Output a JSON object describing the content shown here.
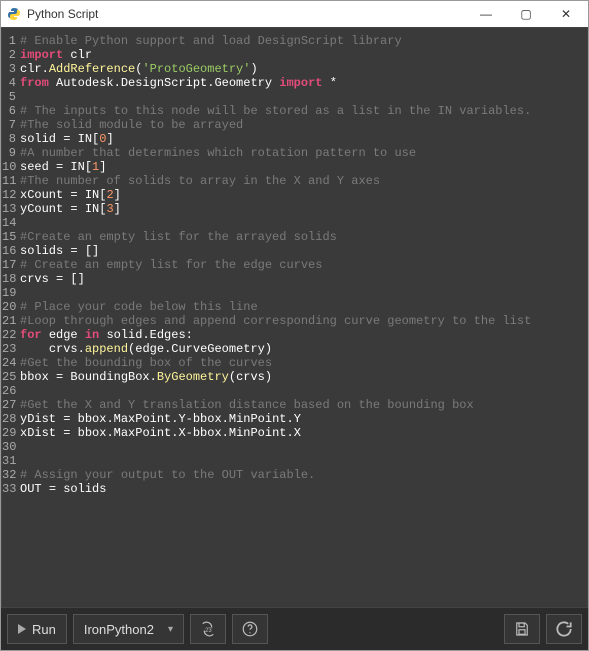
{
  "window": {
    "title": "Python Script",
    "controls": {
      "min": "—",
      "max": "▢",
      "close": "✕"
    }
  },
  "editor": {
    "total_lines": 33,
    "lines": [
      [
        {
          "t": "com",
          "s": "# Enable Python support and load DesignScript library"
        }
      ],
      [
        {
          "t": "kw",
          "s": "import"
        },
        {
          "t": null,
          "s": " "
        },
        {
          "t": "nm",
          "s": "clr"
        }
      ],
      [
        {
          "t": "nm",
          "s": "clr"
        },
        {
          "t": "op",
          "s": "."
        },
        {
          "t": "id2",
          "s": "AddReference"
        },
        {
          "t": "op",
          "s": "("
        },
        {
          "t": "str",
          "s": "'ProtoGeometry'"
        },
        {
          "t": "op",
          "s": ")"
        }
      ],
      [
        {
          "t": "kw",
          "s": "from"
        },
        {
          "t": null,
          "s": " "
        },
        {
          "t": "nm",
          "s": "Autodesk.DesignScript.Geometry"
        },
        {
          "t": null,
          "s": " "
        },
        {
          "t": "kw",
          "s": "import"
        },
        {
          "t": null,
          "s": " "
        },
        {
          "t": "op",
          "s": "*"
        }
      ],
      [],
      [
        {
          "t": "com",
          "s": "# The inputs to this node will be stored as a list in the IN variables."
        }
      ],
      [
        {
          "t": "com",
          "s": "#The solid module to be arrayed"
        }
      ],
      [
        {
          "t": "nm",
          "s": "solid "
        },
        {
          "t": "op",
          "s": "="
        },
        {
          "t": "nm",
          "s": " IN"
        },
        {
          "t": "op",
          "s": "["
        },
        {
          "t": "num",
          "s": "0"
        },
        {
          "t": "op",
          "s": "]"
        }
      ],
      [
        {
          "t": "com",
          "s": "#A number that determines which rotation pattern to use"
        }
      ],
      [
        {
          "t": "nm",
          "s": "seed "
        },
        {
          "t": "op",
          "s": "="
        },
        {
          "t": "nm",
          "s": " IN"
        },
        {
          "t": "op",
          "s": "["
        },
        {
          "t": "num",
          "s": "1"
        },
        {
          "t": "op",
          "s": "]"
        }
      ],
      [
        {
          "t": "com",
          "s": "#The number of solids to array in the X and Y axes"
        }
      ],
      [
        {
          "t": "nm",
          "s": "xCount "
        },
        {
          "t": "op",
          "s": "="
        },
        {
          "t": "nm",
          "s": " IN"
        },
        {
          "t": "op",
          "s": "["
        },
        {
          "t": "num",
          "s": "2"
        },
        {
          "t": "op",
          "s": "]"
        }
      ],
      [
        {
          "t": "nm",
          "s": "yCount "
        },
        {
          "t": "op",
          "s": "="
        },
        {
          "t": "nm",
          "s": " IN"
        },
        {
          "t": "op",
          "s": "["
        },
        {
          "t": "num",
          "s": "3"
        },
        {
          "t": "op",
          "s": "]"
        }
      ],
      [],
      [
        {
          "t": "com",
          "s": "#Create an empty list for the arrayed solids"
        }
      ],
      [
        {
          "t": "nm",
          "s": "solids "
        },
        {
          "t": "op",
          "s": "="
        },
        {
          "t": "nm",
          "s": " "
        },
        {
          "t": "op",
          "s": "[]"
        }
      ],
      [
        {
          "t": "com",
          "s": "# Create an empty list for the edge curves"
        }
      ],
      [
        {
          "t": "nm",
          "s": "crvs "
        },
        {
          "t": "op",
          "s": "="
        },
        {
          "t": "nm",
          "s": " "
        },
        {
          "t": "op",
          "s": "[]"
        }
      ],
      [],
      [
        {
          "t": "com",
          "s": "# Place your code below this line"
        }
      ],
      [
        {
          "t": "com",
          "s": "#Loop through edges and append corresponding curve geometry to the list"
        }
      ],
      [
        {
          "t": "kw",
          "s": "for"
        },
        {
          "t": null,
          "s": " "
        },
        {
          "t": "nm",
          "s": "edge"
        },
        {
          "t": null,
          "s": " "
        },
        {
          "t": "kw",
          "s": "in"
        },
        {
          "t": null,
          "s": " "
        },
        {
          "t": "nm",
          "s": "solid"
        },
        {
          "t": "op",
          "s": "."
        },
        {
          "t": "nm",
          "s": "Edges"
        },
        {
          "t": "op",
          "s": ":"
        }
      ],
      [
        {
          "t": null,
          "s": "    "
        },
        {
          "t": "nm",
          "s": "crvs"
        },
        {
          "t": "op",
          "s": "."
        },
        {
          "t": "id2",
          "s": "append"
        },
        {
          "t": "op",
          "s": "("
        },
        {
          "t": "nm",
          "s": "edge"
        },
        {
          "t": "op",
          "s": "."
        },
        {
          "t": "nm",
          "s": "CurveGeometry"
        },
        {
          "t": "op",
          "s": ")"
        }
      ],
      [
        {
          "t": "com",
          "s": "#Get the bounding box of the curves"
        }
      ],
      [
        {
          "t": "nm",
          "s": "bbox "
        },
        {
          "t": "op",
          "s": "="
        },
        {
          "t": "nm",
          "s": " BoundingBox"
        },
        {
          "t": "op",
          "s": "."
        },
        {
          "t": "id2",
          "s": "ByGeometry"
        },
        {
          "t": "op",
          "s": "("
        },
        {
          "t": "nm",
          "s": "crvs"
        },
        {
          "t": "op",
          "s": ")"
        }
      ],
      [],
      [
        {
          "t": "com",
          "s": "#Get the X and Y translation distance based on the bounding box"
        }
      ],
      [
        {
          "t": "nm",
          "s": "yDist "
        },
        {
          "t": "op",
          "s": "="
        },
        {
          "t": "nm",
          "s": " bbox"
        },
        {
          "t": "op",
          "s": "."
        },
        {
          "t": "nm",
          "s": "MaxPoint"
        },
        {
          "t": "op",
          "s": "."
        },
        {
          "t": "nm",
          "s": "Y"
        },
        {
          "t": "op",
          "s": "-"
        },
        {
          "t": "nm",
          "s": "bbox"
        },
        {
          "t": "op",
          "s": "."
        },
        {
          "t": "nm",
          "s": "MinPoint"
        },
        {
          "t": "op",
          "s": "."
        },
        {
          "t": "nm",
          "s": "Y"
        }
      ],
      [
        {
          "t": "nm",
          "s": "xDist "
        },
        {
          "t": "op",
          "s": "="
        },
        {
          "t": "nm",
          "s": " bbox"
        },
        {
          "t": "op",
          "s": "."
        },
        {
          "t": "nm",
          "s": "MaxPoint"
        },
        {
          "t": "op",
          "s": "."
        },
        {
          "t": "nm",
          "s": "X"
        },
        {
          "t": "op",
          "s": "-"
        },
        {
          "t": "nm",
          "s": "bbox"
        },
        {
          "t": "op",
          "s": "."
        },
        {
          "t": "nm",
          "s": "MinPoint"
        },
        {
          "t": "op",
          "s": "."
        },
        {
          "t": "nm",
          "s": "X"
        }
      ],
      [],
      [],
      [
        {
          "t": "com",
          "s": "# Assign your output to the OUT variable."
        }
      ],
      [
        {
          "t": "nm",
          "s": "OUT "
        },
        {
          "t": "op",
          "s": "="
        },
        {
          "t": "nm",
          "s": " solids"
        }
      ]
    ]
  },
  "footer": {
    "run_label": "Run",
    "engine": "IronPython2"
  }
}
